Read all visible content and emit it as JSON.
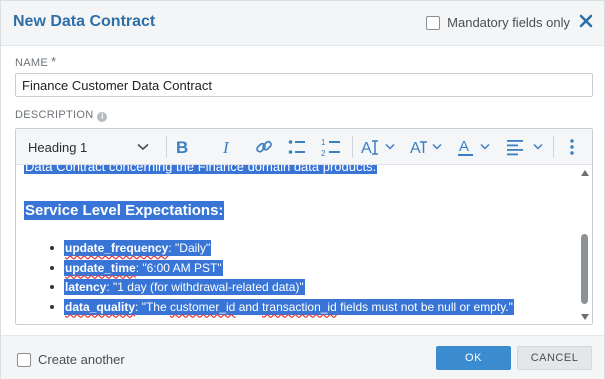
{
  "dialog": {
    "title": "New Data Contract",
    "mandatory_label": "Mandatory fields only",
    "close_icon": "close-icon"
  },
  "fields": {
    "name_label": "NAME",
    "name_required_mark": "*",
    "name_value": "Finance Customer Data Contract",
    "description_label": "DESCRIPTION",
    "description_info_icon": "info-icon"
  },
  "toolbar": {
    "heading_select": "Heading 1",
    "icons": [
      "bold-icon",
      "italic-icon",
      "link-icon",
      "bulleted-list-icon",
      "numbered-list-icon",
      "font-size-icon",
      "text-style-icon",
      "font-color-icon",
      "align-icon",
      "more-icon"
    ]
  },
  "content": {
    "intro": "Data Contract concerning the Finance domain data products.",
    "heading": "Service Level Expectations:",
    "items": [
      {
        "key": "update_frequency",
        "value": ": \"Daily\""
      },
      {
        "key": "update_time",
        "value": ": \"6:00 AM PST\""
      },
      {
        "key": "latency",
        "value": ": \"1 day (for withdrawal-related data)\""
      },
      {
        "key": "data_quality",
        "value": ": \"The ",
        "tail": "customer_id",
        "tail2": " and ",
        "tail3": "transaction_id",
        "tail4": " fields must not be null or empty.\""
      }
    ]
  },
  "footer": {
    "create_another_label": "Create another",
    "ok_label": "OK",
    "cancel_label": "CANCEL"
  },
  "colors": {
    "accent": "#2e6fa8",
    "selection": "#3875d7",
    "ok_button": "#3b8bd0"
  }
}
